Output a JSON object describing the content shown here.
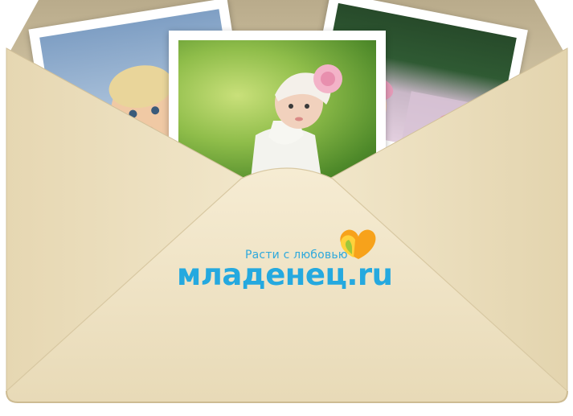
{
  "logo": {
    "tagline": "Расти с любовью",
    "brand": "младенец.ru",
    "colors": {
      "brand_blue": "#25a9df",
      "heart_orange": "#f7a21b",
      "heart_yellow": "#ffd23b",
      "heart_green": "#9fc73a"
    }
  },
  "photos": [
    {
      "subject": "baby-boy-photo"
    },
    {
      "subject": "baby-girl-pink-flower-hat-photo"
    },
    {
      "subject": "babies-on-blanket-photo"
    }
  ],
  "envelope": {
    "color": "#f1e6c9"
  }
}
